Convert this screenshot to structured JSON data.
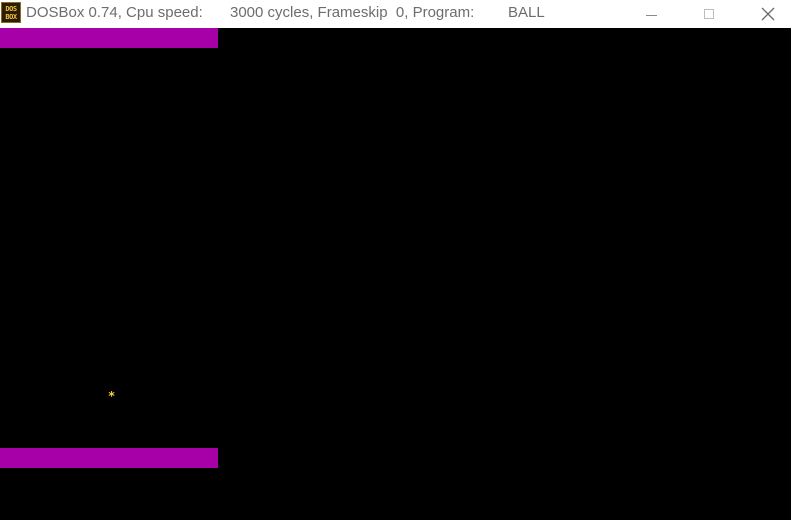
{
  "titlebar": {
    "icon_text_top": "DOS",
    "icon_text_bottom": "BOX",
    "app_title": "DOSBox 0.74, Cpu speed:",
    "cycles_info": "3000 cycles, Frameskip  0, Program:",
    "program": "BALL"
  },
  "window_controls": {
    "icons": [
      "minimize-icon",
      "maximize-icon",
      "close-icon"
    ],
    "close_glyph": "✕"
  },
  "game": {
    "ball_glyph": "*",
    "colors": {
      "background": "#000000",
      "paddle": "#a800a8",
      "ball": "#ffd040"
    }
  }
}
